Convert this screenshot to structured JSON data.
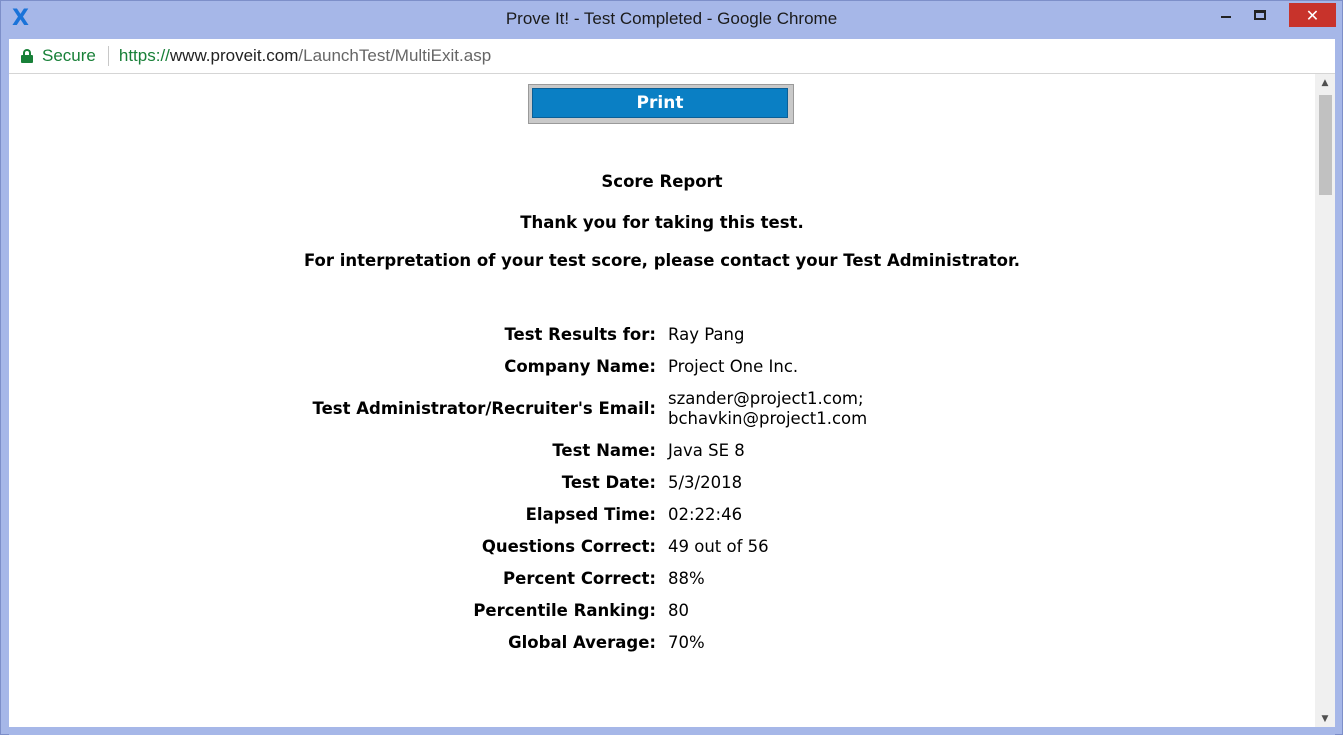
{
  "window": {
    "title": "Prove It! - Test Completed - Google Chrome",
    "app_icon": "proveit-x-logo"
  },
  "address_bar": {
    "secure_label": "Secure",
    "url_scheme": "https://",
    "url_host": "www.proveit.com",
    "url_path": "/LaunchTest/MultiExit.asp"
  },
  "page": {
    "print_label": "Print",
    "score_report": "Score Report",
    "thanks": "Thank you for taking this test.",
    "interpretation": "For interpretation of your test score, please contact your Test Administrator.",
    "results": [
      {
        "label": "Test Results for:",
        "value": "Ray Pang"
      },
      {
        "label": "Company Name:",
        "value": "Project One Inc."
      },
      {
        "label": "Test Administrator/Recruiter's Email:",
        "value": "szander@project1.com;",
        "value2": "bchavkin@project1.com"
      },
      {
        "label": "Test Name:",
        "value": "Java SE 8"
      },
      {
        "label": "Test Date:",
        "value": "5/3/2018"
      },
      {
        "label": "Elapsed Time:",
        "value": "02:22:46"
      },
      {
        "label": "Questions Correct:",
        "value": "49 out of 56"
      },
      {
        "label": "Percent Correct:",
        "value": "88%"
      },
      {
        "label": "Percentile Ranking:",
        "value": "80"
      },
      {
        "label": "Global Average:",
        "value": "70%"
      }
    ]
  },
  "colors": {
    "print_button": "#0a7fc4",
    "secure_green": "#188038",
    "close_button": "#c8332b"
  }
}
